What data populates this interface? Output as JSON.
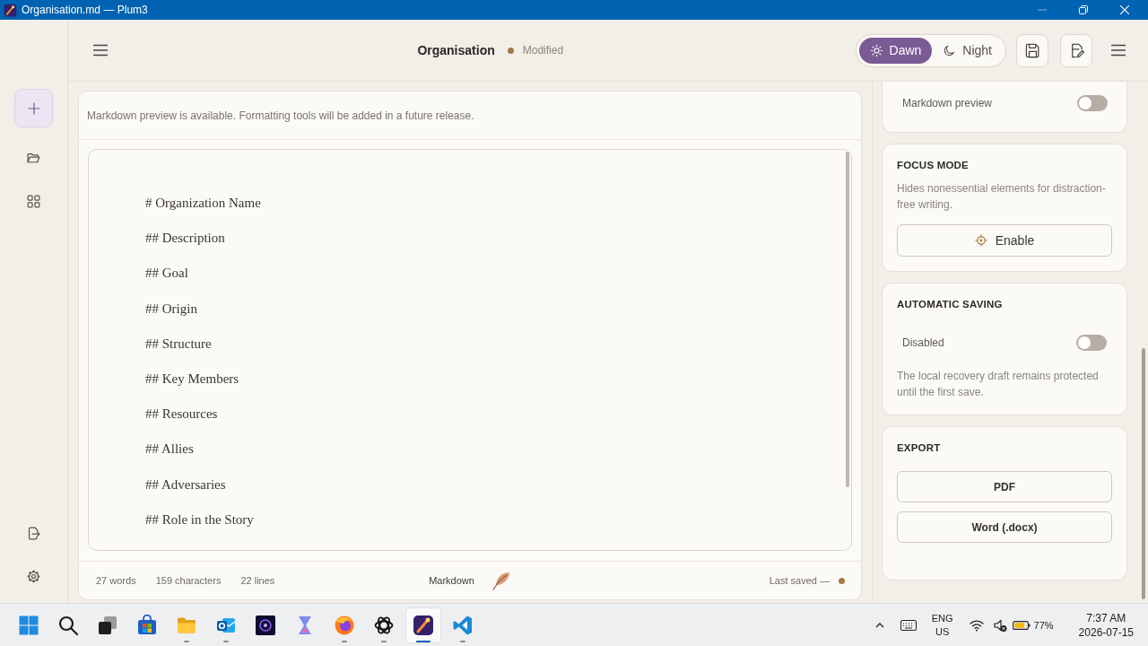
{
  "window": {
    "title": "Organisation.md — Plum3"
  },
  "header": {
    "title": "Organisation",
    "status": "Modified",
    "theme_options": [
      {
        "label": "Dawn",
        "kind": "sun",
        "selected": true
      },
      {
        "label": "Night",
        "kind": "moon",
        "selected": false
      }
    ]
  },
  "editor": {
    "notice": "Markdown preview is available. Formatting tools will be added in a future release.",
    "lines": [
      "# Organization Name",
      "## Description",
      "## Goal",
      "## Origin",
      "## Structure",
      "## Key Members",
      "## Resources",
      "## Allies",
      "## Adversaries",
      "## Role in the Story"
    ],
    "status_bar": {
      "words": "27 words",
      "characters": "159 characters",
      "lines": "22 lines",
      "mode": "Markdown",
      "last_saved": "Last saved —"
    }
  },
  "settings_panel": {
    "preview": {
      "label": "Markdown preview",
      "on": false
    },
    "focus_mode": {
      "title": "FOCUS MODE",
      "description": "Hides nonessential elements for distraction-free writing.",
      "button": "Enable"
    },
    "automatic_saving": {
      "title": "AUTOMATIC SAVING",
      "label": "Disabled",
      "on": false,
      "note": "The local recovery draft remains protected until the first save."
    },
    "export": {
      "title": "EXPORT",
      "buttons": [
        "PDF",
        "Word (.docx)"
      ]
    }
  },
  "taskbar": {
    "apps": [
      {
        "kind": "start",
        "running": false,
        "selected": false
      },
      {
        "kind": "search",
        "running": false,
        "selected": false
      },
      {
        "kind": "taskview",
        "running": false,
        "selected": false
      },
      {
        "kind": "store",
        "running": false,
        "selected": false
      },
      {
        "kind": "explorer",
        "running": true,
        "selected": false
      },
      {
        "kind": "mail",
        "running": true,
        "selected": false
      },
      {
        "kind": "galaxy",
        "running": false,
        "selected": false
      },
      {
        "kind": "hourglass",
        "running": false,
        "selected": false
      },
      {
        "kind": "browser",
        "running": true,
        "selected": false
      },
      {
        "kind": "assistant",
        "running": true,
        "selected": false
      },
      {
        "kind": "writer",
        "running": true,
        "selected": true
      },
      {
        "kind": "code",
        "running": true,
        "selected": false
      }
    ],
    "tray": {
      "language": "ENG",
      "region": "US",
      "battery": "77%",
      "time": "7:37 AM",
      "date": "2026-07-15"
    }
  }
}
